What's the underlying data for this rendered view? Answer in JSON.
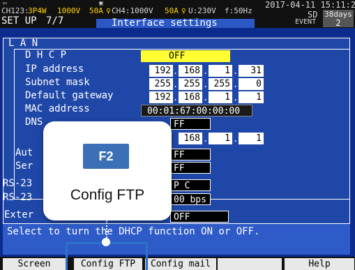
{
  "status": {
    "ch123_label": "CH123:",
    "ch123_wiring": "3P4W",
    "ch123_voltage": "1000V",
    "ch123_current": "50A",
    "ch4_label": "CH4:1000V",
    "ch4_current": "50A",
    "u_label": "U:230V",
    "freq_label": "f:50Hz",
    "datetime": "2017-04-11 15:11:26",
    "sd_label": "SD",
    "sd_days": "38days",
    "screen_title": "SET UP",
    "page": "7/7",
    "section_title": "Interface settings",
    "event_label": "EVENT",
    "event_count": "2"
  },
  "lan": {
    "header": "L A N",
    "dhcp_label": "D H C P",
    "dhcp_value": "OFF",
    "ip_label": "IP address",
    "ip": [
      "192",
      "168",
      "1",
      "31"
    ],
    "subnet_label": "Subnet mask",
    "subnet": [
      "255",
      "255",
      "255",
      "0"
    ],
    "gateway_label": "Default gateway",
    "gateway": [
      "192",
      "168",
      "1",
      "1"
    ],
    "mac_label": "MAC address",
    "mac": "00:01:67:00:00:00",
    "dns_label": "DNS",
    "dns_value_top": "FF",
    "dns_ip": [
      "168",
      "1",
      "1"
    ],
    "auto_label": "Aut",
    "auto_value": "FF",
    "server_label": "Ser",
    "server_value": "FF"
  },
  "rs232": {
    "label1": "RS-23",
    "value1": "P C",
    "label2": "RS-23",
    "value2": "00 bps"
  },
  "external": {
    "label": "Exter",
    "value": "OFF"
  },
  "help_text": "Select to turn the DHCP function ON or OFF.",
  "fkeys": {
    "f1": "Screen",
    "f2": "Config FTP",
    "f3": "Config mail",
    "f5": "Help"
  },
  "callout": {
    "key": "F2",
    "label": "Config FTP"
  },
  "colors": {
    "panel_bg": "#1f47a8",
    "highlight": "#ffff33",
    "callout_key": "#3b6fb6"
  }
}
